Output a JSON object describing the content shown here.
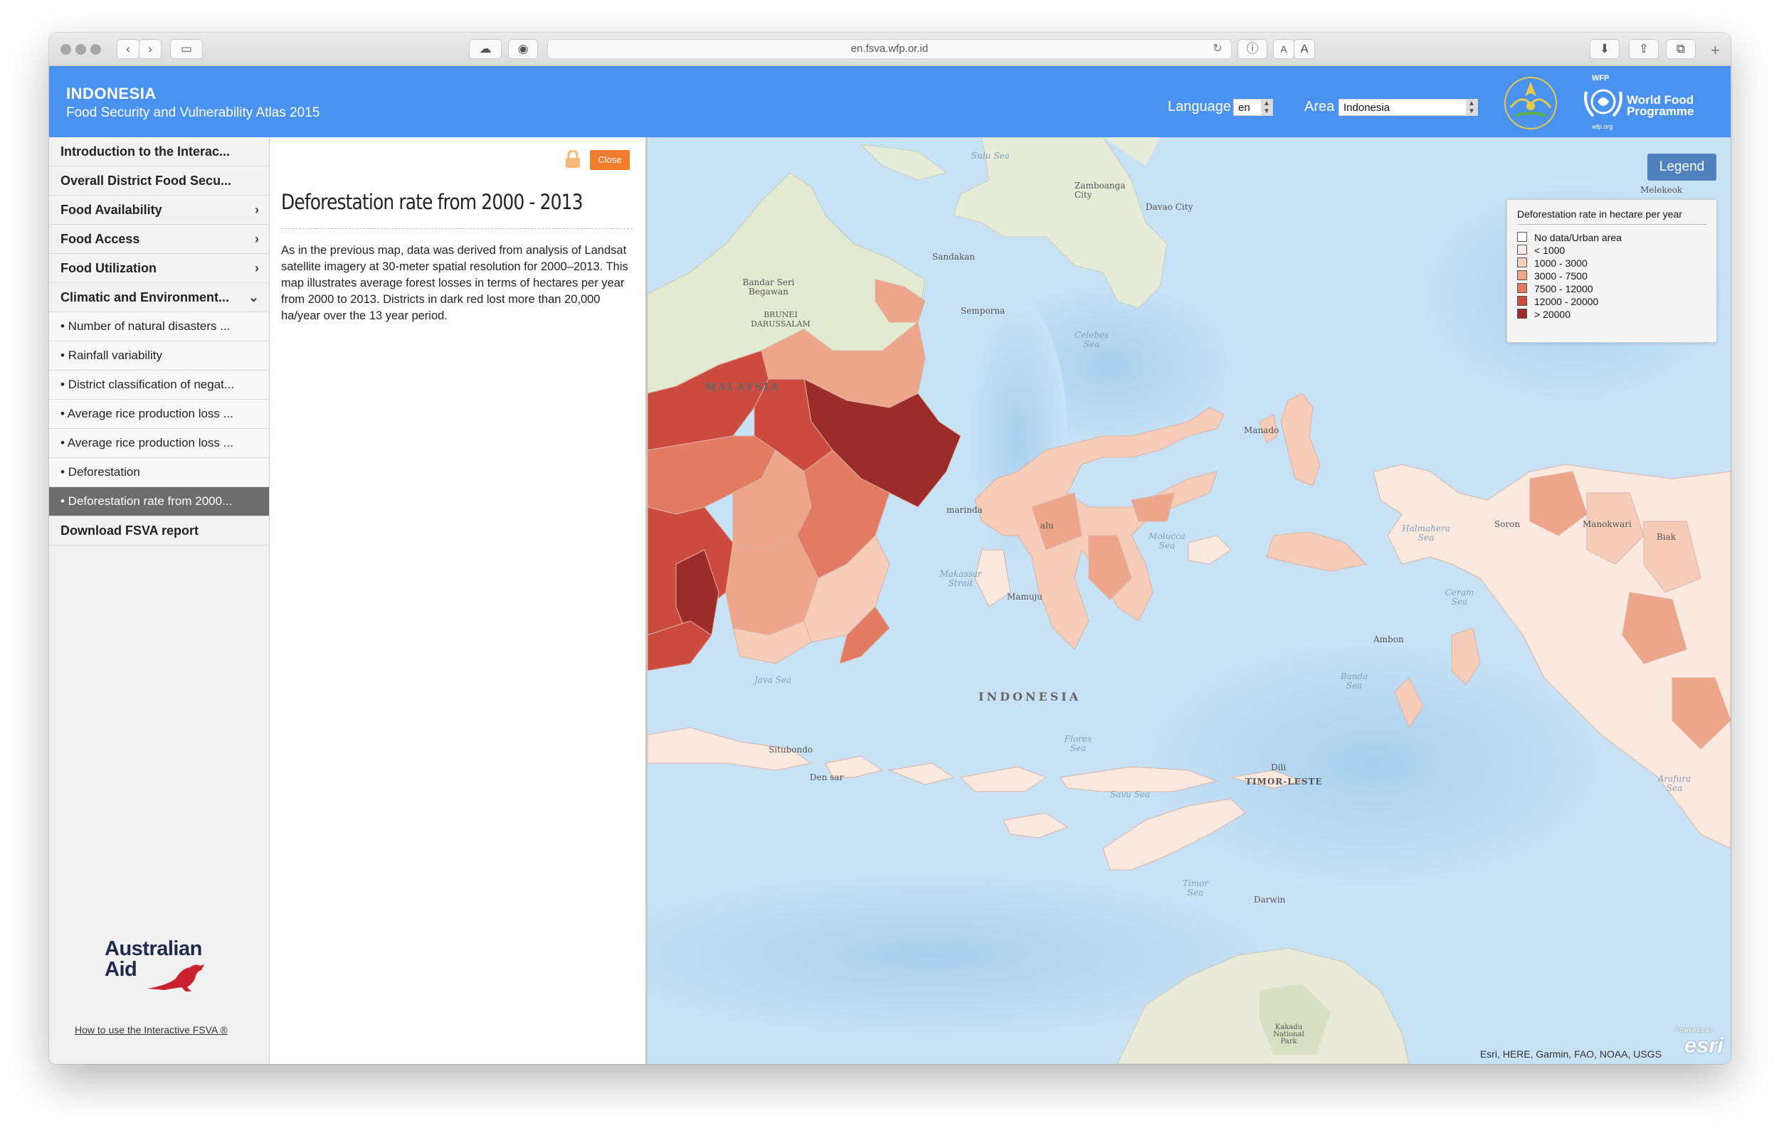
{
  "browser": {
    "url": "en.fsva.wfp.or.id",
    "text_small": "A",
    "text_large": "A"
  },
  "header": {
    "country": "INDONESIA",
    "subtitle": "Food Security and Vulnerability Atlas 2015",
    "language_label": "Language",
    "language_value": "en",
    "area_label": "Area",
    "area_value": "Indonesia",
    "wfp_top": "WFP",
    "wfp_line1": "World Food",
    "wfp_line2": "Programme",
    "wfp_url": "wfp.org"
  },
  "sidebar": {
    "items": [
      {
        "label": "Introduction to the Interac..."
      },
      {
        "label": "Overall District Food Secu..."
      },
      {
        "label": "Food Availability"
      },
      {
        "label": "Food Access"
      },
      {
        "label": "Food Utilization"
      },
      {
        "label": "Climatic and Environment..."
      },
      {
        "label": "• Number of natural disasters ..."
      },
      {
        "label": "• Rainfall variability"
      },
      {
        "label": "• District classification of negat..."
      },
      {
        "label": "• Average rice production loss ..."
      },
      {
        "label": "• Average rice production loss ..."
      },
      {
        "label": "• Deforestation"
      },
      {
        "label": "• Deforestation rate from 2000..."
      },
      {
        "label": "Download FSVA report"
      }
    ],
    "sponsor_line1": "Australian",
    "sponsor_line2": "Aid",
    "howto": "How to use the Interactive FSVA"
  },
  "panel": {
    "close_label": "Close",
    "title": "Deforestation rate from 2000 - 2013",
    "body": "As in the previous map, data was derived from analysis of Landsat satellite imagery at 30-meter spatial resolution for 2000–2013. This map illustrates average forest losses in terms of hectares per year from 2000 to 2013. Districts in dark red lost more than 20,000 ha/year over the 13 year period."
  },
  "map": {
    "legend_button": "Legend",
    "legend_title": "Deforestation rate in hectare per year",
    "legend_items": [
      {
        "label": "No data/Urban area",
        "color": "#ffffff"
      },
      {
        "label": "< 1000",
        "color": "#fbe9e0"
      },
      {
        "label": "1000 - 3000",
        "color": "#f6cdb8"
      },
      {
        "label": "3000 - 7500",
        "color": "#eea68a"
      },
      {
        "label": "7500 - 12000",
        "color": "#e27b62"
      },
      {
        "label": "12000 - 20000",
        "color": "#cd4a3f"
      },
      {
        "label": "> 20000",
        "color": "#9c2c2a"
      }
    ],
    "labels": {
      "sulu_sea": "Sulu Sea",
      "zamboanga": "Zamboanga City",
      "davao": "Davao City",
      "melekeok": "Melekeok",
      "sandakan": "Sandakan",
      "bandar": "Bandar Seri Begawan",
      "brunei": "BRUNEI DARUSSALAM",
      "semporna": "Semporna",
      "celebes": "Celebes Sea",
      "malaysia": "MALAYSIA",
      "manado": "Manado",
      "samarinda": "marinda",
      "palu": "alu",
      "molucca": "Molucca Sea",
      "halmahera": "Halmahera Sea",
      "sorong": "Soron",
      "manokwari": "Manokwari",
      "biak": "Biak",
      "makassar": "Makassar Strait",
      "mamuju": "Mamuju",
      "ceram": "Ceram Sea",
      "ambon": "Ambon",
      "java_sea": "Java Sea",
      "indonesia": "INDONESIA",
      "banda": "Banda Sea",
      "flores": "Flores Sea",
      "situbondo": "Situbondo",
      "denpasar": "Den   sar",
      "dili": "Dili",
      "timor": "TIMOR-LESTE",
      "savu": "Savu Sea",
      "arafura": "Arafura Sea",
      "timor_sea": "Timor Sea",
      "darwin": "Darwin",
      "kakadu": "Kakadu National Park"
    },
    "attribution": "Esri, HERE, Garmin, FAO, NOAA, USGS",
    "esri_small": "POWERED BY",
    "esri": "esri"
  }
}
